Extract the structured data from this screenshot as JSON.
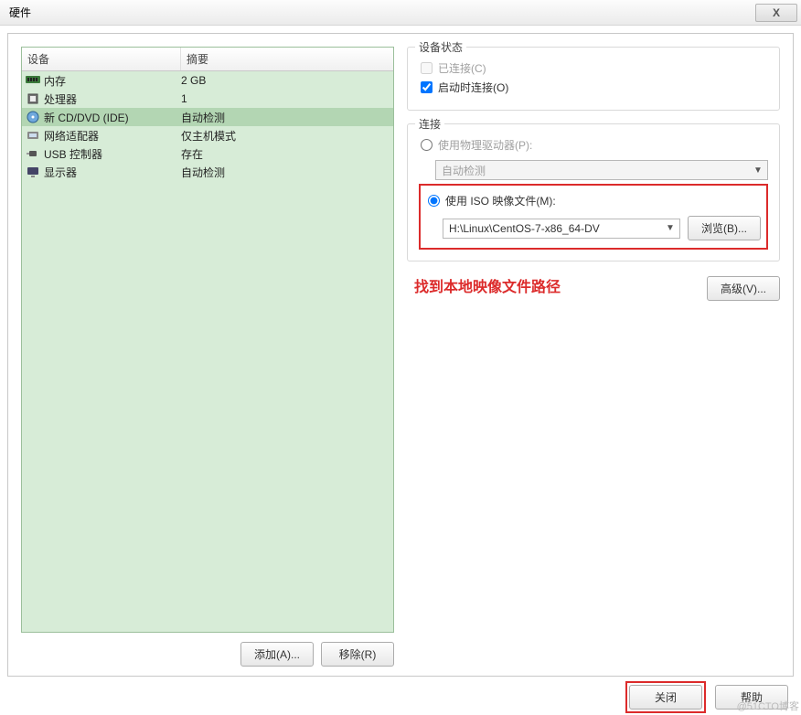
{
  "window": {
    "title": "硬件",
    "close_glyph": "X"
  },
  "table": {
    "header_device": "设备",
    "header_summary": "摘要",
    "rows": [
      {
        "icon": "memory-icon",
        "name": "内存",
        "summary": "2 GB",
        "selected": false
      },
      {
        "icon": "cpu-icon",
        "name": "处理器",
        "summary": "1",
        "selected": false
      },
      {
        "icon": "disc-icon",
        "name": "新 CD/DVD (IDE)",
        "summary": "自动检测",
        "selected": true
      },
      {
        "icon": "network-icon",
        "name": "网络适配器",
        "summary": "仅主机模式",
        "selected": false
      },
      {
        "icon": "usb-icon",
        "name": "USB 控制器",
        "summary": "存在",
        "selected": false
      },
      {
        "icon": "display-icon",
        "name": "显示器",
        "summary": "自动检测",
        "selected": false
      }
    ]
  },
  "buttons": {
    "add": "添加(A)...",
    "remove": "移除(R)",
    "browse": "浏览(B)...",
    "advanced": "高级(V)...",
    "close": "关闭",
    "help": "帮助"
  },
  "status": {
    "legend": "设备状态",
    "connected_label": "已连接(C)",
    "connected_checked": false,
    "connected_enabled": false,
    "connect_at_power_on_label": "启动时连接(O)",
    "connect_at_power_on_checked": true
  },
  "connection": {
    "legend": "连接",
    "physical_label": "使用物理驱动器(P):",
    "physical_selected": false,
    "physical_drive_value": "自动检测",
    "iso_label": "使用 ISO 映像文件(M):",
    "iso_selected": true,
    "iso_path": "H:\\Linux\\CentOS-7-x86_64-DV"
  },
  "annotation": "找到本地映像文件路径",
  "watermark": "@51CTO博客"
}
